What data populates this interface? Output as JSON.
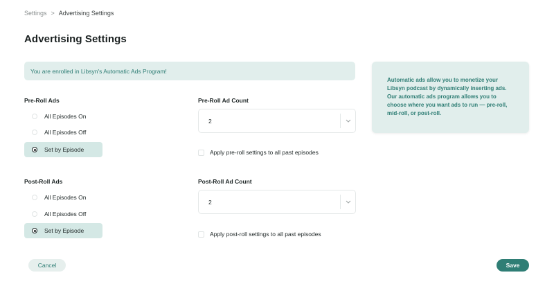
{
  "breadcrumb": {
    "parent": "Settings",
    "separator": ">",
    "current": "Advertising Settings"
  },
  "page_title": "Advertising Settings",
  "banner": {
    "text": "You are enrolled in Libsyn's Automatic Ads Program!"
  },
  "info_card": {
    "text": "Automatic ads allow you to monetize your Libsyn podcast by dynamically inserting ads. Our automatic ads program allows you to choose where you want ads to run — pre-roll, mid-roll, or post-roll."
  },
  "pre_roll": {
    "label": "Pre-Roll Ads",
    "options": [
      "All Episodes On",
      "All Episodes Off",
      "Set by Episode"
    ],
    "selected": "Set by Episode",
    "count_label": "Pre-Roll Ad Count",
    "count_value": "2",
    "apply_label": "Apply pre-roll settings to all past episodes",
    "apply_checked": false
  },
  "post_roll": {
    "label": "Post-Roll Ads",
    "options": [
      "All Episodes On",
      "All Episodes Off",
      "Set by Episode"
    ],
    "selected": "Set by Episode",
    "count_label": "Post-Roll Ad Count",
    "count_value": "2",
    "apply_label": "Apply post-roll settings to all past episodes",
    "apply_checked": false
  },
  "actions": {
    "cancel_label": "Cancel",
    "save_label": "Save"
  },
  "colors": {
    "accent": "#2f7e75",
    "accent_light": "#e1eeec",
    "selected_bg": "#d4e8e5"
  },
  "icons": {
    "select_arrow": "chevron-down-icon"
  }
}
